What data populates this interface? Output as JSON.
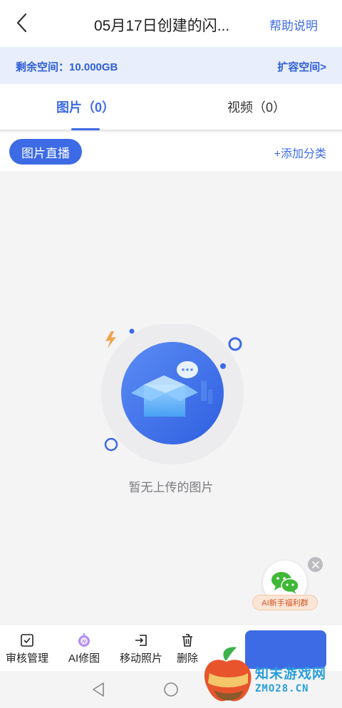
{
  "header": {
    "title": "05月17日创建的闪...",
    "help_label": "帮助说明"
  },
  "storage": {
    "label": "剩余空间：10.000GB",
    "expand_label": "扩容空间>"
  },
  "tabs": [
    {
      "label": "图片（0）",
      "active": true
    },
    {
      "label": "视频（0）",
      "active": false
    }
  ],
  "filter": {
    "live_label": "图片直播",
    "add_category_label": "+添加分类"
  },
  "empty_state": {
    "message": "暂无上传的图片"
  },
  "wechat_widget": {
    "label": "AI新手福利群"
  },
  "bottom_actions": [
    {
      "label": "审核管理",
      "icon": "checkbox-icon"
    },
    {
      "label": "AI修图",
      "icon": "ai-robot-icon"
    },
    {
      "label": "移动照片",
      "icon": "move-icon"
    },
    {
      "label": "删除",
      "icon": "trash-icon"
    }
  ],
  "watermark": {
    "title": "知末游戏网",
    "url": "ZMO28.CN"
  },
  "colors": {
    "accent": "#3d6be6",
    "space_bar_bg": "#e8eefb",
    "page_bg": "#f4f4f5",
    "wechat_green": "#3fb837",
    "badge_orange": "#d2541f"
  }
}
